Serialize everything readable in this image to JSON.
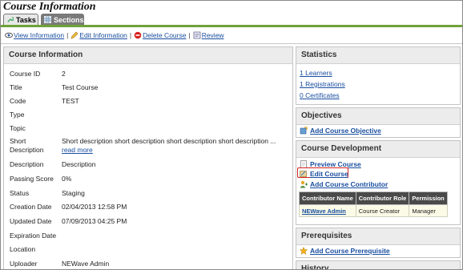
{
  "page": {
    "title": "Course Information"
  },
  "tabs": [
    {
      "label": "Tasks",
      "icon": "wrench-icon",
      "active": true
    },
    {
      "label": "Sections",
      "icon": "grid-icon",
      "active": false
    }
  ],
  "actions": [
    {
      "label": "View Information",
      "icon": "eye-icon"
    },
    {
      "label": "Edit Information",
      "icon": "pencil-icon"
    },
    {
      "label": "Delete Course",
      "icon": "delete-icon"
    },
    {
      "label": "Review",
      "icon": "review-icon"
    }
  ],
  "info": {
    "title": "Course Information",
    "rows": [
      {
        "label": "Course ID",
        "value": "2"
      },
      {
        "label": "Title",
        "value": "Test Course"
      },
      {
        "label": "Code",
        "value": "TEST"
      },
      {
        "label": "Type",
        "value": ""
      },
      {
        "label": "Topic",
        "value": ""
      },
      {
        "label": "Short Description",
        "value": "Short description short description short description short description ...",
        "link": "read more"
      },
      {
        "label": "Description",
        "value": "Description"
      },
      {
        "label": "Passing Score",
        "value": "0%"
      },
      {
        "label": "Status",
        "value": "Staging"
      },
      {
        "label": "Creation Date",
        "value": "02/04/2013 12:58 PM"
      },
      {
        "label": "Updated Date",
        "value": "07/09/2013 04:25 PM"
      },
      {
        "label": "Expiration Date",
        "value": ""
      },
      {
        "label": "Location",
        "value": ""
      },
      {
        "label": "Uploader",
        "value": "NEWave Admin"
      }
    ]
  },
  "statistics": {
    "title": "Statistics",
    "links": [
      "1 Learners",
      "1 Registrations",
      "0 Certificates"
    ]
  },
  "objectives": {
    "title": "Objectives",
    "link": "Add Course Objective"
  },
  "development": {
    "title": "Course Development",
    "links": [
      "Preview Course",
      "Edit Course",
      "Add Course Contributor"
    ],
    "table": {
      "headers": [
        "Contributor Name",
        "Contributor Role",
        "Permission"
      ],
      "rows": [
        [
          "NEWave Admin",
          "Course Creator",
          "Manager"
        ]
      ]
    }
  },
  "prerequisites": {
    "title": "Prerequisites",
    "link": "Add Course Prerequisite"
  },
  "history": {
    "title": "History"
  },
  "colors": {
    "accent_green": "#6fa23a",
    "link_blue": "#1a4fa0",
    "highlight_red": "#d8231f",
    "table_header": "#4a4a4a"
  }
}
